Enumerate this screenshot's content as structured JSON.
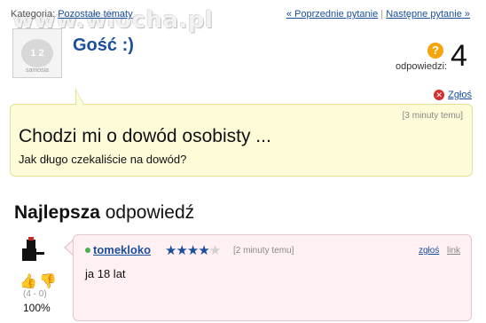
{
  "header": {
    "category_prefix": "Kategoria:",
    "category_link": "Pozostałe tematy",
    "watermark": "www.wiocha.pl",
    "prev_label": "« Poprzednie pytanie",
    "separator": "|",
    "next_label": "Następne pytanie »"
  },
  "asker": {
    "avatar_brand": "samosia",
    "name": "Gość :)"
  },
  "answers": {
    "label": "odpowiedzi:",
    "count": "4",
    "icon": "question-mark-icon"
  },
  "report": {
    "label": "Zgłoś",
    "icon": "close-icon"
  },
  "question": {
    "time": "[3 minuty temu]",
    "title": "Chodzi mi o dowód osobisty ...",
    "body": "Jak długo czekaliście na dowód?"
  },
  "best_answer": {
    "heading_bold": "Najlepsza",
    "heading_rest": "odpowiedź",
    "votes": {
      "up_icon": "thumbs-up-icon",
      "down_icon": "thumbs-down-icon",
      "counts": "(4 - 0)",
      "percent": "100%"
    },
    "user": "tomekloko",
    "rating": 4,
    "rating_max": 5,
    "time": "[2 minuty temu]",
    "report_label": "zgłoś",
    "link_label": "link",
    "body": "ja 18 lat"
  },
  "colors": {
    "link": "#1b4f9c",
    "question_bg": "#fdfbd8",
    "answer_bg": "#fff1f3",
    "answers_icon": "#f5a40c",
    "report_icon": "#d32f2f"
  }
}
